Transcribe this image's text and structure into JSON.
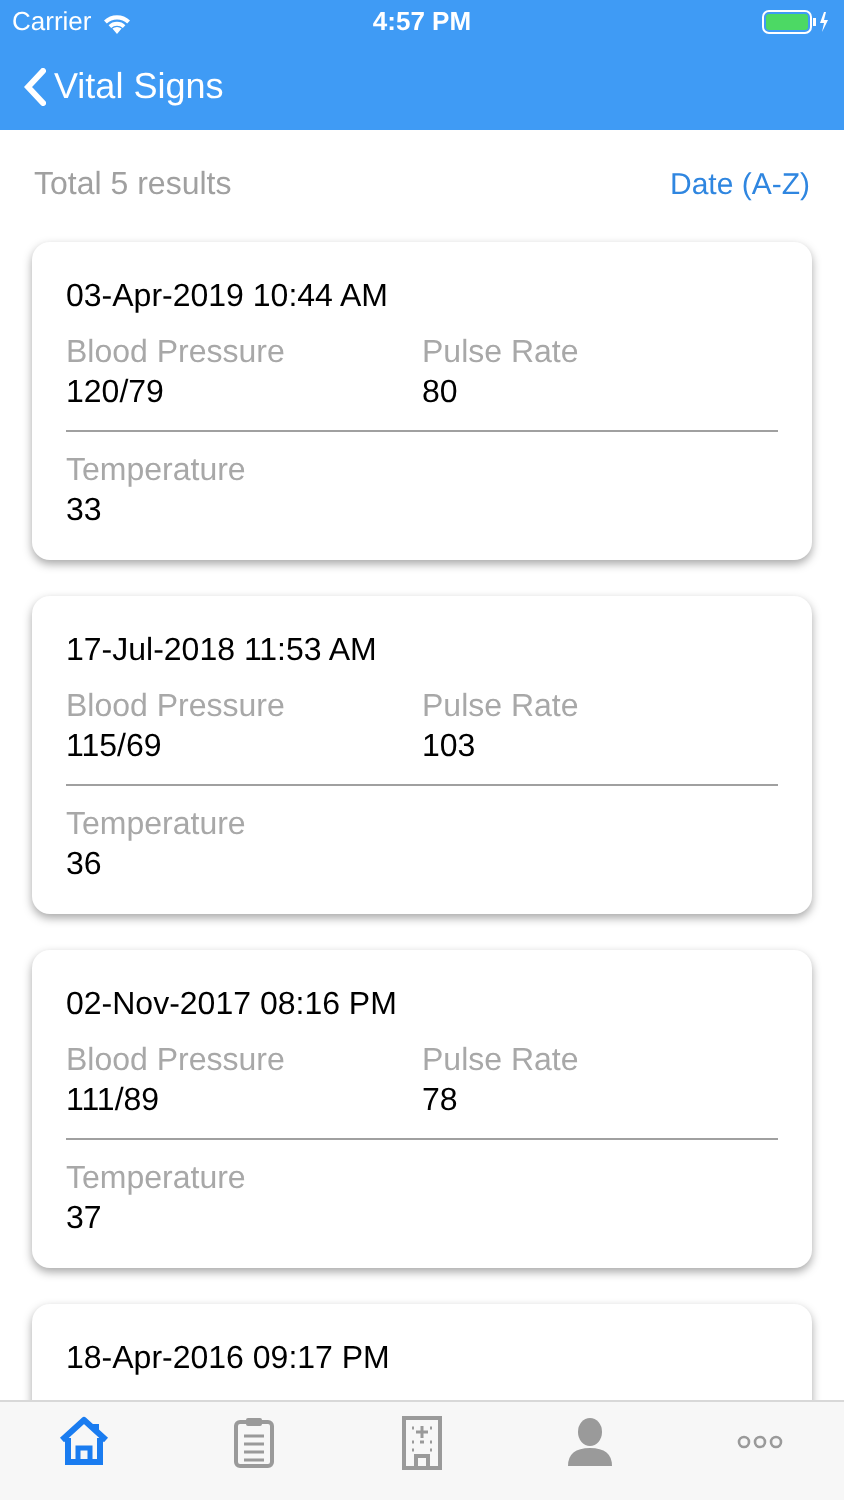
{
  "status_bar": {
    "carrier": "Carrier",
    "time": "4:57 PM"
  },
  "nav_bar": {
    "title": "Vital Signs"
  },
  "list_header": {
    "total": "Total 5 results",
    "sort": "Date (A-Z)"
  },
  "records": [
    {
      "date": "03-Apr-2019 10:44 AM",
      "fields": [
        {
          "label": "Blood Pressure",
          "value": "120/79"
        },
        {
          "label": "Pulse Rate",
          "value": "80"
        },
        {
          "label": "Temperature",
          "value": "33"
        }
      ]
    },
    {
      "date": "17-Jul-2018 11:53 AM",
      "fields": [
        {
          "label": "Blood Pressure",
          "value": "115/69"
        },
        {
          "label": "Pulse Rate",
          "value": "103"
        },
        {
          "label": "Temperature",
          "value": "36"
        }
      ]
    },
    {
      "date": "02-Nov-2017 08:16 PM",
      "fields": [
        {
          "label": "Blood Pressure",
          "value": "111/89"
        },
        {
          "label": "Pulse Rate",
          "value": "78"
        },
        {
          "label": "Temperature",
          "value": "37"
        }
      ]
    },
    {
      "date": "18-Apr-2016 09:17 PM"
    }
  ],
  "tab_bar": [
    {
      "kind": "home",
      "selected": true
    },
    {
      "kind": "clipboard",
      "selected": false
    },
    {
      "kind": "hospital",
      "selected": false
    },
    {
      "kind": "person",
      "selected": false
    },
    {
      "kind": "more",
      "selected": false
    }
  ]
}
